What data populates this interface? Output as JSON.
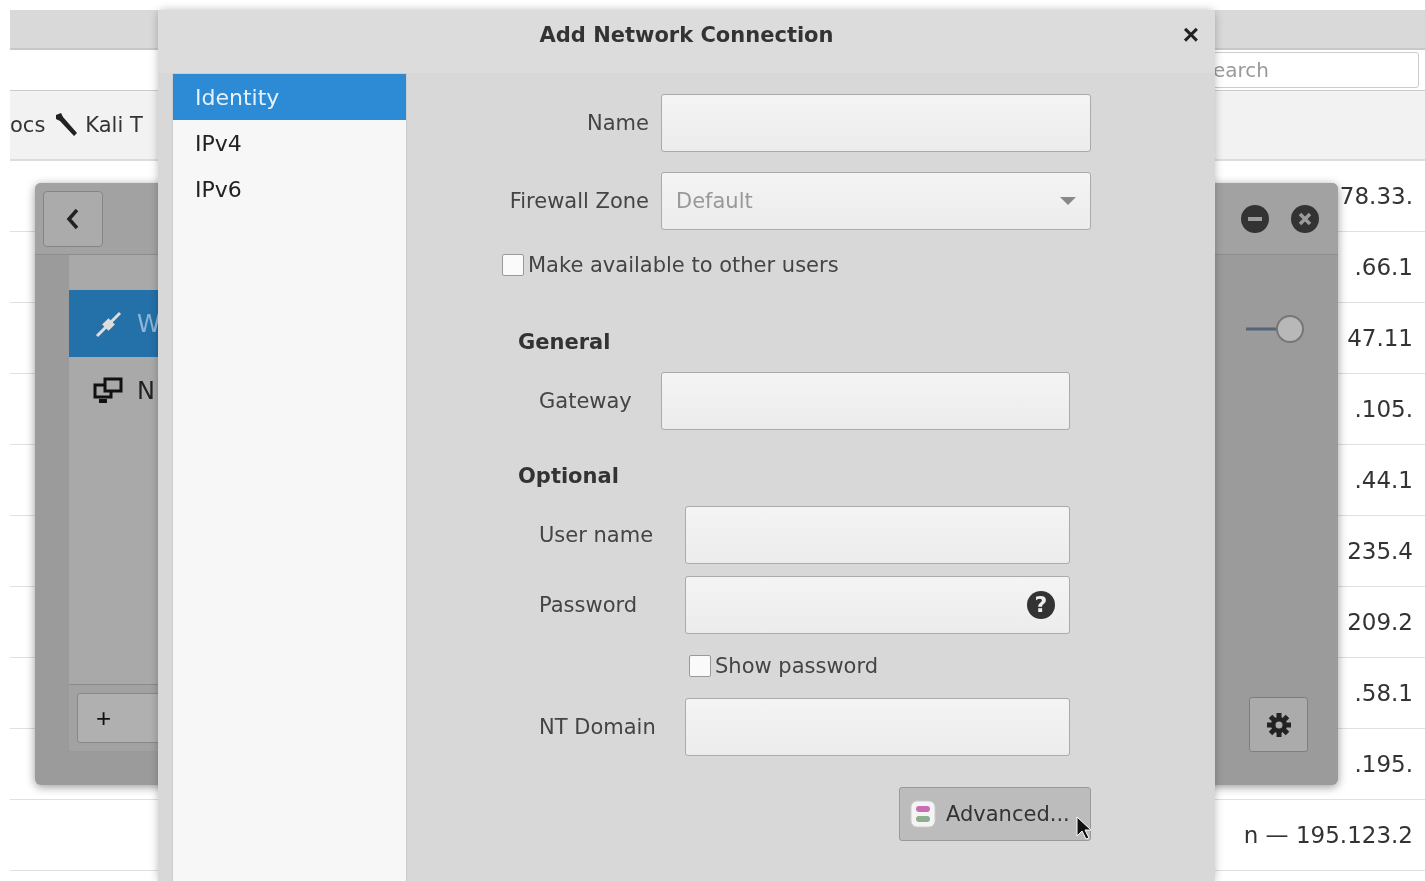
{
  "browser": {
    "search": {
      "placeholder": "earch"
    },
    "bookmarks": [
      {
        "label": "ocs"
      },
      {
        "label": "Kali T"
      }
    ],
    "rows": [
      {
        "text": "78.33."
      },
      {
        "text": ".66.1"
      },
      {
        "text": "47.11"
      },
      {
        "text": ".105."
      },
      {
        "text": ".44.1"
      },
      {
        "text": "235.4"
      },
      {
        "text": "209.2"
      },
      {
        "text": ".58.1"
      },
      {
        "text": ".195."
      },
      {
        "text": "n — 195.123.2"
      }
    ]
  },
  "settings_window": {
    "list": [
      {
        "label": "W",
        "selected": true
      },
      {
        "label": "N",
        "selected": false
      }
    ],
    "add_button": "+"
  },
  "dialog": {
    "title": "Add Network Connection",
    "close": "×",
    "sidebar": [
      {
        "label": "Identity",
        "selected": true
      },
      {
        "label": "IPv4",
        "selected": false
      },
      {
        "label": "IPv6",
        "selected": false
      }
    ],
    "sections": [
      {
        "fields": [
          {
            "kind": "text",
            "label": "Name"
          },
          {
            "kind": "select",
            "label": "Firewall Zone",
            "value": "Default"
          },
          {
            "kind": "check",
            "label": "Make available to other users",
            "checked": false
          }
        ]
      },
      {
        "heading": "General",
        "fields": [
          {
            "kind": "text",
            "label": "Gateway"
          }
        ]
      },
      {
        "heading": "Optional",
        "fields": [
          {
            "kind": "text",
            "label": "User name"
          },
          {
            "kind": "password",
            "label": "Password",
            "hint_icon": "?"
          },
          {
            "kind": "check",
            "label": "Show password",
            "checked": false
          },
          {
            "kind": "text",
            "label": "NT Domain"
          }
        ]
      }
    ],
    "advanced_button": "Advanced..."
  }
}
